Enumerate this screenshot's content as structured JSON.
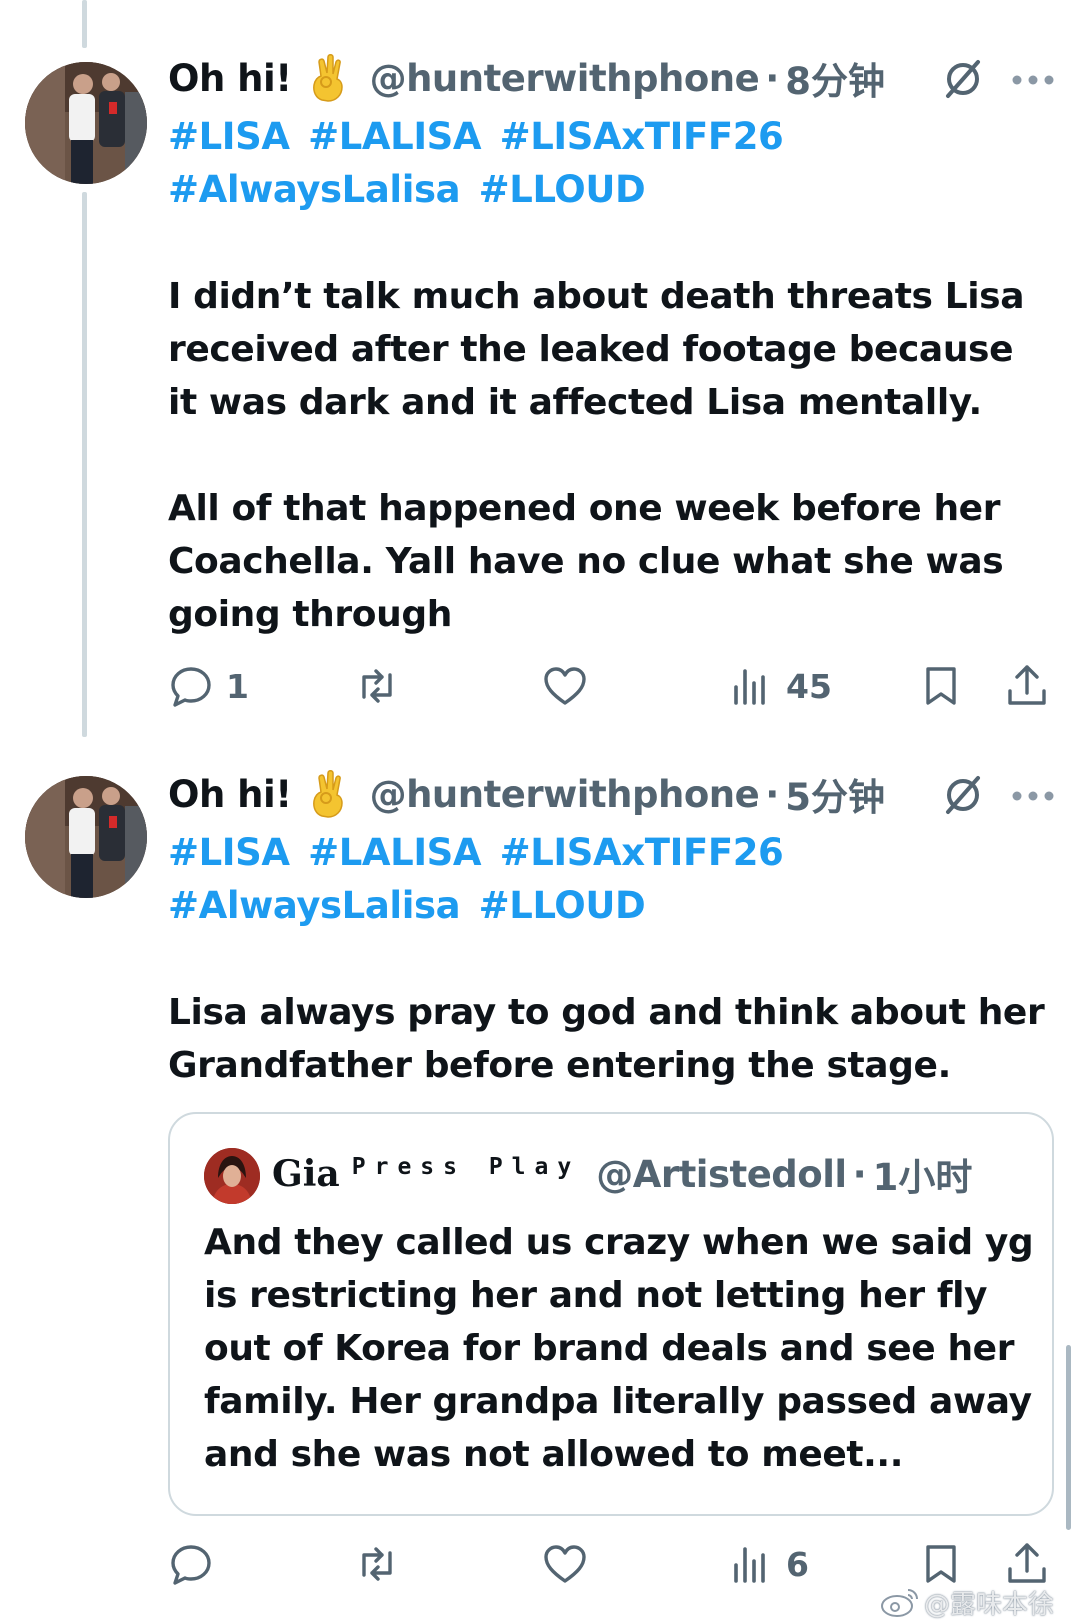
{
  "tweets": [
    {
      "name": "Oh hi!",
      "handle": "@hunterwithphone",
      "separator": "·",
      "time": "8分钟",
      "hashtags": [
        "#LISA",
        "#LALISA",
        "#LISAxTIFF26",
        "#AlwaysLalisa",
        "#LLOUD"
      ],
      "paragraphs": [
        "I didn’t talk much about death threats Lisa received after the leaked footage because it was dark and it affected Lisa mentally.",
        "All of that happened one week before her Coachella. Yall have no clue what she was going through"
      ],
      "actions": {
        "replies": "1",
        "reposts": "",
        "likes": "",
        "views": "45"
      }
    },
    {
      "name": "Oh hi!",
      "handle": "@hunterwithphone",
      "separator": "·",
      "time": "5分钟",
      "hashtags": [
        "#LISA",
        "#LALISA",
        "#LISAxTIFF26",
        "#AlwaysLalisa",
        "#LLOUD"
      ],
      "paragraphs": [
        "Lisa always pray to god and think about her Grandfather before entering the stage."
      ],
      "quote": {
        "name": "Gia",
        "subtitle": "Press Play",
        "handle": "@Artistedoll",
        "separator": "·",
        "time": "1小时",
        "text": "And they called us crazy when we said yg is restricting her and not letting her fly out of Korea for brand deals and see her family. Her grandpa literally passed away and she was not allowed to meet..."
      },
      "actions": {
        "replies": "",
        "reposts": "",
        "likes": "",
        "views": "6"
      }
    }
  ],
  "watermark": "@露味本徐",
  "colors": {
    "hashtag": "#1d9bf0",
    "muted": "#536471",
    "text": "#0f1419",
    "border": "#cfd9de"
  },
  "icons": [
    "ok-hand-emoji",
    "grok-icon",
    "more-icon",
    "reply-icon",
    "repost-icon",
    "like-icon",
    "views-icon",
    "bookmark-icon",
    "share-icon",
    "weibo-icon"
  ]
}
